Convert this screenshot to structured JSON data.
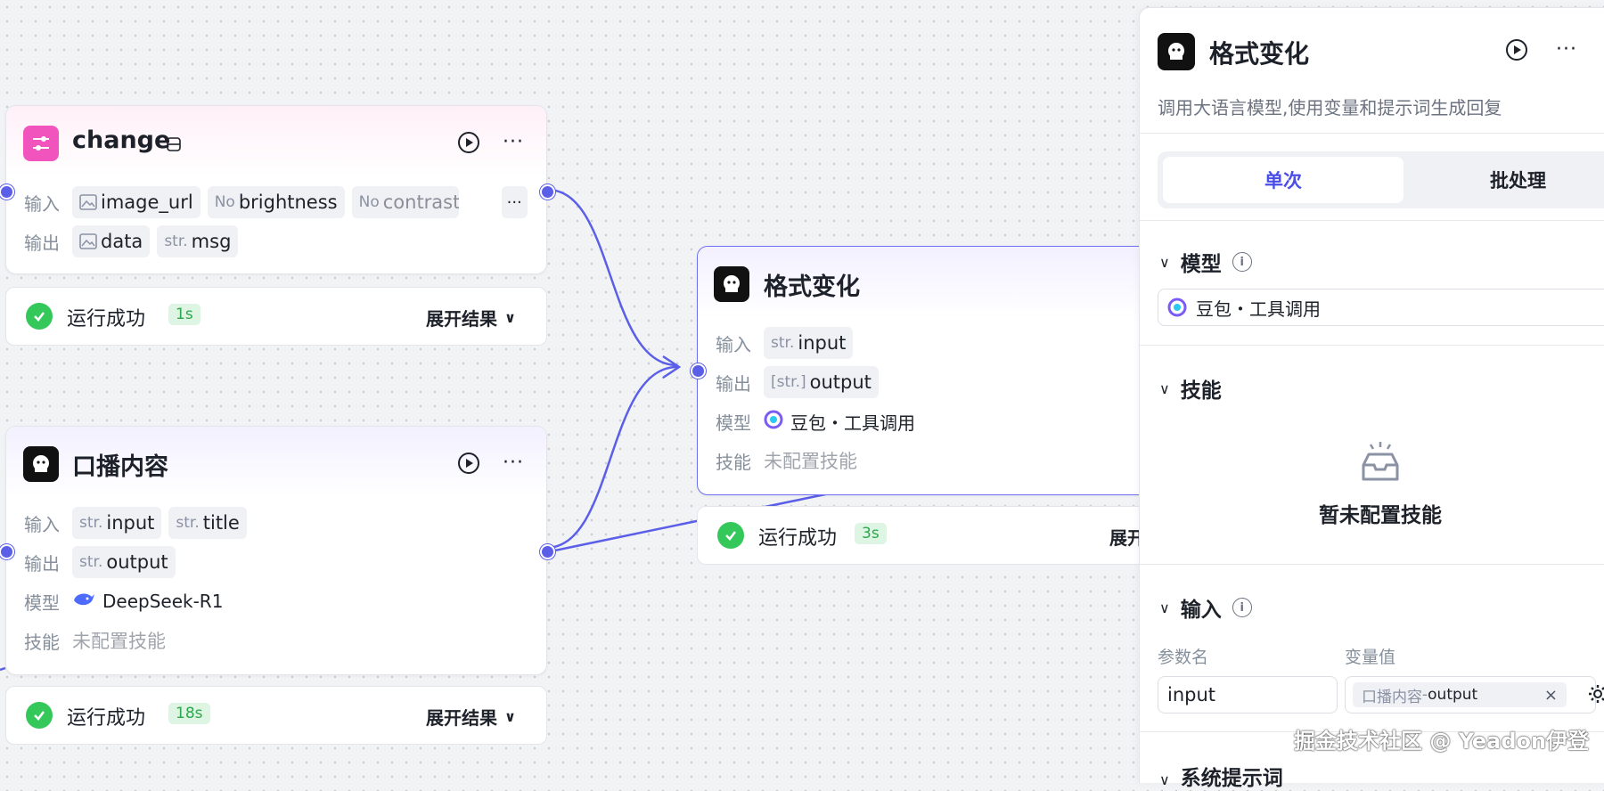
{
  "nodes": {
    "change": {
      "title": "change",
      "input_label": "输入",
      "output_label": "输出",
      "inputs": [
        {
          "type": "img",
          "name": "image_url"
        },
        {
          "type": "No",
          "name": "brightness"
        },
        {
          "type": "No",
          "name": "contrast"
        }
      ],
      "outputs": [
        {
          "type": "img",
          "name": "data"
        },
        {
          "type": "str.",
          "name": "msg"
        }
      ],
      "status": {
        "text": "运行成功",
        "time": "1s",
        "expand": "展开结果"
      }
    },
    "koubo": {
      "title": "口播内容",
      "input_label": "输入",
      "output_label": "输出",
      "model_label": "模型",
      "skill_label": "技能",
      "inputs": [
        {
          "type": "str.",
          "name": "input"
        },
        {
          "type": "str.",
          "name": "title"
        }
      ],
      "outputs": [
        {
          "type": "str.",
          "name": "output"
        }
      ],
      "model": "DeepSeek-R1",
      "skill": "未配置技能",
      "status": {
        "text": "运行成功",
        "time": "18s",
        "expand": "展开结果"
      }
    },
    "geshi": {
      "title": "格式变化",
      "input_label": "输入",
      "output_label": "输出",
      "model_label": "模型",
      "skill_label": "技能",
      "inputs": [
        {
          "type": "str.",
          "name": "input"
        }
      ],
      "outputs": [
        {
          "type": "[str.]",
          "name": "output"
        }
      ],
      "model": "豆包・工具调用",
      "skill": "未配置技能",
      "status": {
        "text": "运行成功",
        "time": "3s",
        "expand": "展开"
      }
    }
  },
  "panel": {
    "title": "格式变化",
    "description": "调用大语言模型,使用变量和提示词生成回复",
    "tabs": [
      "单次",
      "批处理"
    ],
    "model_section": "模型",
    "model_value": "豆包・工具调用",
    "skill_section": "技能",
    "skill_empty": "暂未配置技能",
    "input_section": "输入",
    "param_name_label": "参数名",
    "var_value_label": "变量值",
    "param_name": "input",
    "var_value_node": "口播内容",
    "var_value_sep": " - ",
    "var_value_field": "output",
    "sys_prompt_section": "系统提示词"
  },
  "watermark": "掘金技术社区 @ Yeadon伊登",
  "colors": {
    "accent": "#5b5fe8",
    "success": "#34c759",
    "pink": "#f254be"
  }
}
